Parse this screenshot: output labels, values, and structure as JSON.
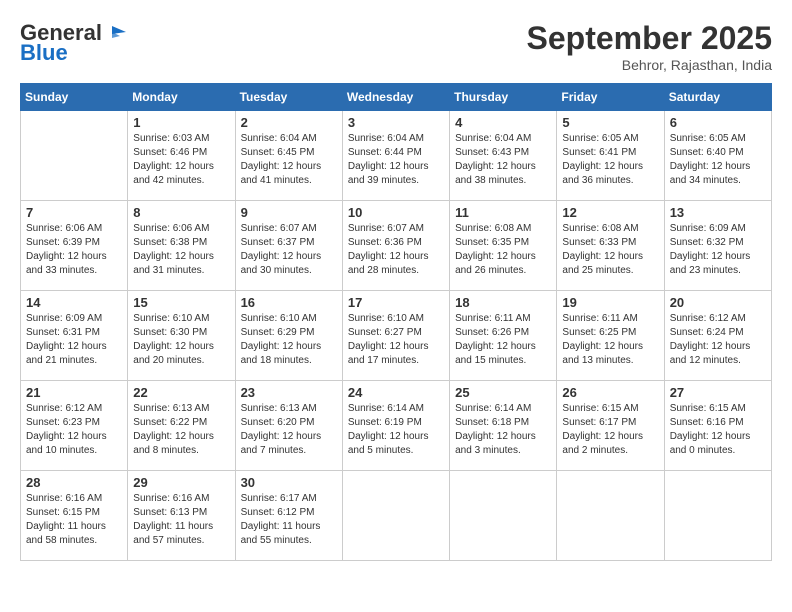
{
  "header": {
    "logo_line1": "General",
    "logo_line2": "Blue",
    "month": "September 2025",
    "location": "Behror, Rajasthan, India"
  },
  "weekdays": [
    "Sunday",
    "Monday",
    "Tuesday",
    "Wednesday",
    "Thursday",
    "Friday",
    "Saturday"
  ],
  "weeks": [
    [
      {
        "day": "",
        "sunrise": "",
        "sunset": "",
        "daylight": ""
      },
      {
        "day": "1",
        "sunrise": "6:03 AM",
        "sunset": "6:46 PM",
        "daylight": "12 hours and 42 minutes."
      },
      {
        "day": "2",
        "sunrise": "6:04 AM",
        "sunset": "6:45 PM",
        "daylight": "12 hours and 41 minutes."
      },
      {
        "day": "3",
        "sunrise": "6:04 AM",
        "sunset": "6:44 PM",
        "daylight": "12 hours and 39 minutes."
      },
      {
        "day": "4",
        "sunrise": "6:04 AM",
        "sunset": "6:43 PM",
        "daylight": "12 hours and 38 minutes."
      },
      {
        "day": "5",
        "sunrise": "6:05 AM",
        "sunset": "6:41 PM",
        "daylight": "12 hours and 36 minutes."
      },
      {
        "day": "6",
        "sunrise": "6:05 AM",
        "sunset": "6:40 PM",
        "daylight": "12 hours and 34 minutes."
      }
    ],
    [
      {
        "day": "7",
        "sunrise": "6:06 AM",
        "sunset": "6:39 PM",
        "daylight": "12 hours and 33 minutes."
      },
      {
        "day": "8",
        "sunrise": "6:06 AM",
        "sunset": "6:38 PM",
        "daylight": "12 hours and 31 minutes."
      },
      {
        "day": "9",
        "sunrise": "6:07 AM",
        "sunset": "6:37 PM",
        "daylight": "12 hours and 30 minutes."
      },
      {
        "day": "10",
        "sunrise": "6:07 AM",
        "sunset": "6:36 PM",
        "daylight": "12 hours and 28 minutes."
      },
      {
        "day": "11",
        "sunrise": "6:08 AM",
        "sunset": "6:35 PM",
        "daylight": "12 hours and 26 minutes."
      },
      {
        "day": "12",
        "sunrise": "6:08 AM",
        "sunset": "6:33 PM",
        "daylight": "12 hours and 25 minutes."
      },
      {
        "day": "13",
        "sunrise": "6:09 AM",
        "sunset": "6:32 PM",
        "daylight": "12 hours and 23 minutes."
      }
    ],
    [
      {
        "day": "14",
        "sunrise": "6:09 AM",
        "sunset": "6:31 PM",
        "daylight": "12 hours and 21 minutes."
      },
      {
        "day": "15",
        "sunrise": "6:10 AM",
        "sunset": "6:30 PM",
        "daylight": "12 hours and 20 minutes."
      },
      {
        "day": "16",
        "sunrise": "6:10 AM",
        "sunset": "6:29 PM",
        "daylight": "12 hours and 18 minutes."
      },
      {
        "day": "17",
        "sunrise": "6:10 AM",
        "sunset": "6:27 PM",
        "daylight": "12 hours and 17 minutes."
      },
      {
        "day": "18",
        "sunrise": "6:11 AM",
        "sunset": "6:26 PM",
        "daylight": "12 hours and 15 minutes."
      },
      {
        "day": "19",
        "sunrise": "6:11 AM",
        "sunset": "6:25 PM",
        "daylight": "12 hours and 13 minutes."
      },
      {
        "day": "20",
        "sunrise": "6:12 AM",
        "sunset": "6:24 PM",
        "daylight": "12 hours and 12 minutes."
      }
    ],
    [
      {
        "day": "21",
        "sunrise": "6:12 AM",
        "sunset": "6:23 PM",
        "daylight": "12 hours and 10 minutes."
      },
      {
        "day": "22",
        "sunrise": "6:13 AM",
        "sunset": "6:22 PM",
        "daylight": "12 hours and 8 minutes."
      },
      {
        "day": "23",
        "sunrise": "6:13 AM",
        "sunset": "6:20 PM",
        "daylight": "12 hours and 7 minutes."
      },
      {
        "day": "24",
        "sunrise": "6:14 AM",
        "sunset": "6:19 PM",
        "daylight": "12 hours and 5 minutes."
      },
      {
        "day": "25",
        "sunrise": "6:14 AM",
        "sunset": "6:18 PM",
        "daylight": "12 hours and 3 minutes."
      },
      {
        "day": "26",
        "sunrise": "6:15 AM",
        "sunset": "6:17 PM",
        "daylight": "12 hours and 2 minutes."
      },
      {
        "day": "27",
        "sunrise": "6:15 AM",
        "sunset": "6:16 PM",
        "daylight": "12 hours and 0 minutes."
      }
    ],
    [
      {
        "day": "28",
        "sunrise": "6:16 AM",
        "sunset": "6:15 PM",
        "daylight": "11 hours and 58 minutes."
      },
      {
        "day": "29",
        "sunrise": "6:16 AM",
        "sunset": "6:13 PM",
        "daylight": "11 hours and 57 minutes."
      },
      {
        "day": "30",
        "sunrise": "6:17 AM",
        "sunset": "6:12 PM",
        "daylight": "11 hours and 55 minutes."
      },
      {
        "day": "",
        "sunrise": "",
        "sunset": "",
        "daylight": ""
      },
      {
        "day": "",
        "sunrise": "",
        "sunset": "",
        "daylight": ""
      },
      {
        "day": "",
        "sunrise": "",
        "sunset": "",
        "daylight": ""
      },
      {
        "day": "",
        "sunrise": "",
        "sunset": "",
        "daylight": ""
      }
    ]
  ]
}
